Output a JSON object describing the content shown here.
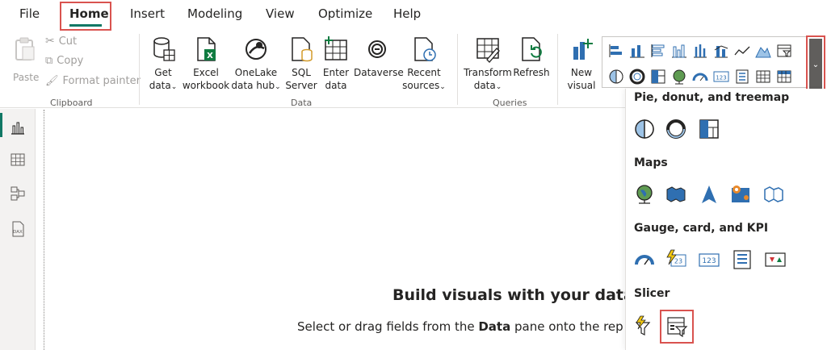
{
  "menu": {
    "file": "File",
    "home": "Home",
    "insert": "Insert",
    "modeling": "Modeling",
    "view": "View",
    "optimize": "Optimize",
    "help": "Help"
  },
  "clipboard": {
    "paste": "Paste",
    "cut": "Cut",
    "copy": "Copy",
    "format_painter": "Format painter",
    "group": "Clipboard"
  },
  "data_group": {
    "get_data": [
      "Get",
      "data"
    ],
    "excel": [
      "Excel",
      "workbook"
    ],
    "onelake": [
      "OneLake",
      "data hub"
    ],
    "sql": [
      "SQL",
      "Server"
    ],
    "enter": [
      "Enter",
      "data"
    ],
    "dataverse": "Dataverse",
    "recent": [
      "Recent",
      "sources"
    ],
    "group": "Data"
  },
  "queries_group": {
    "transform": [
      "Transform",
      "data"
    ],
    "refresh": "Refresh",
    "group": "Queries"
  },
  "new_visual": [
    "New",
    "visual"
  ],
  "panel": {
    "sections": {
      "pie": "Pie, donut, and treemap",
      "maps": "Maps",
      "gauge": "Gauge, card, and KPI",
      "slicer": "Slicer"
    }
  },
  "canvas": {
    "title": "Build visuals with your data",
    "sub_before": "Select or drag fields from the ",
    "sub_bold": "Data",
    "sub_after": " pane onto the rep"
  },
  "colors": {
    "accent": "#117865",
    "highlight": "#d9534f",
    "icon_blue": "#2f6fb1"
  }
}
